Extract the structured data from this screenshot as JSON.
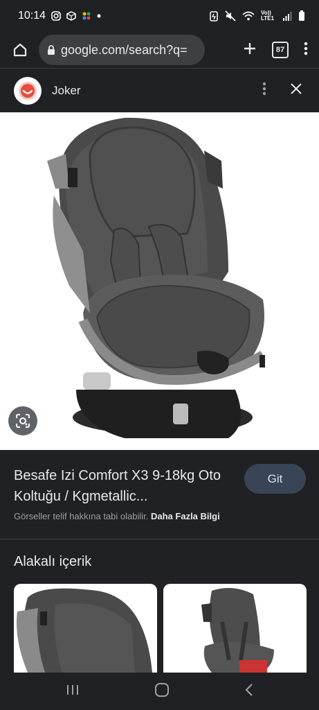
{
  "status_bar": {
    "time": "10:14",
    "network_label": "Vo)) LTE1"
  },
  "browser": {
    "url": "google.com/search?q=",
    "tab_count": "87"
  },
  "panel": {
    "site_name": "Joker"
  },
  "product": {
    "title": "Besafe Izi Comfort X3 9-18kg Oto Koltuğu / Kgmetallic...",
    "visit_label": "Git",
    "copyright_notice": "Görseller telif hakkına tabi olabilir.",
    "more_info_label": "Daha Fazla Bilgi"
  },
  "related": {
    "heading": "Alakalı içerik"
  },
  "colors": {
    "background": "#202124",
    "visit_button_bg": "#394457",
    "joker_red": "#e74c3c"
  }
}
